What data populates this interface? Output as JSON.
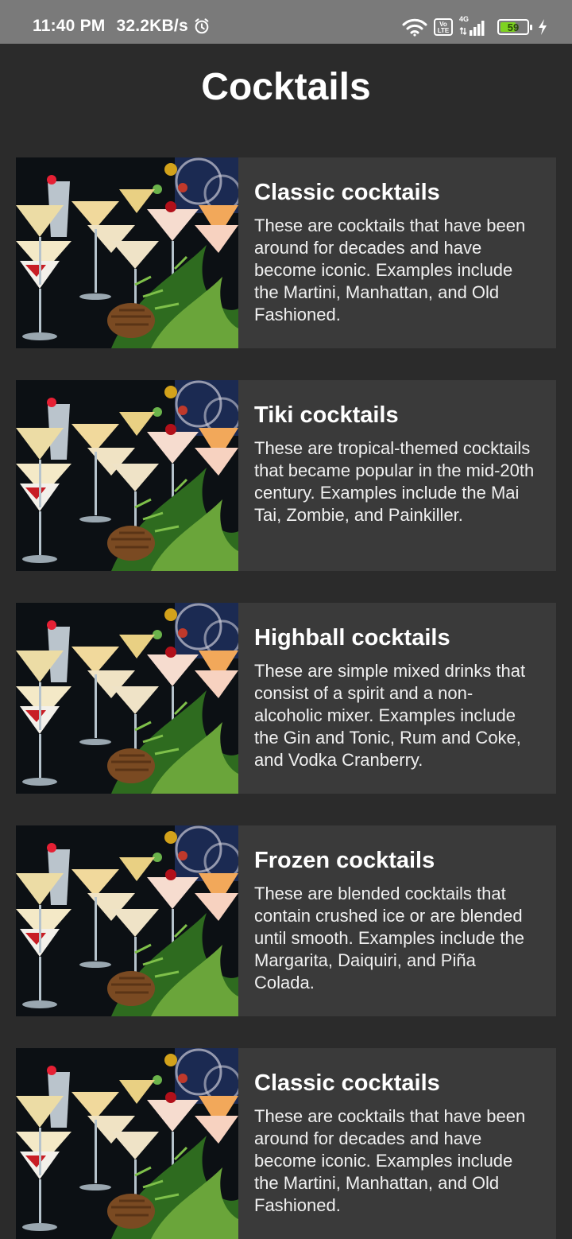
{
  "status_bar": {
    "time": "11:40 PM",
    "speed": "32.2KB/s",
    "icons": [
      "alarm-icon",
      "wifi-icon",
      "volte-icon",
      "signal-icon",
      "battery-icon",
      "charging-icon"
    ],
    "volte_label": "Vo LTE",
    "network_label": "4G",
    "battery_level": "59",
    "battery_fraction": 0.59,
    "battery_color": "#7ed321"
  },
  "page": {
    "title": "Cocktails"
  },
  "cards": [
    {
      "title": "Classic cocktails",
      "description": "These are cocktails that have been around for decades and have become iconic. Examples include the Martini, Manhattan, and Old Fashioned."
    },
    {
      "title": "Tiki cocktails",
      "description": "These are tropical-themed cocktails that became popular in the mid-20th century. Examples include the Mai Tai, Zombie, and Painkiller."
    },
    {
      "title": "Highball cocktails",
      "description": "These are simple mixed drinks that consist of a spirit and a non-alcoholic mixer. Examples include the Gin and Tonic, Rum and Coke, and Vodka Cranberry."
    },
    {
      "title": "Frozen cocktails",
      "description": "These are blended cocktails that contain crushed ice or are blended until smooth. Examples include the Margarita, Daiquiri, and Piña Colada."
    },
    {
      "title": "Classic cocktails",
      "description": "These are cocktails that have been around for decades and have become iconic. Examples include the Martini, Manhattan, and Old Fashioned."
    }
  ],
  "colors": {
    "background": "#2b2b2b",
    "card": "#3a3a3a",
    "status_bar": "#7a7a7a"
  }
}
